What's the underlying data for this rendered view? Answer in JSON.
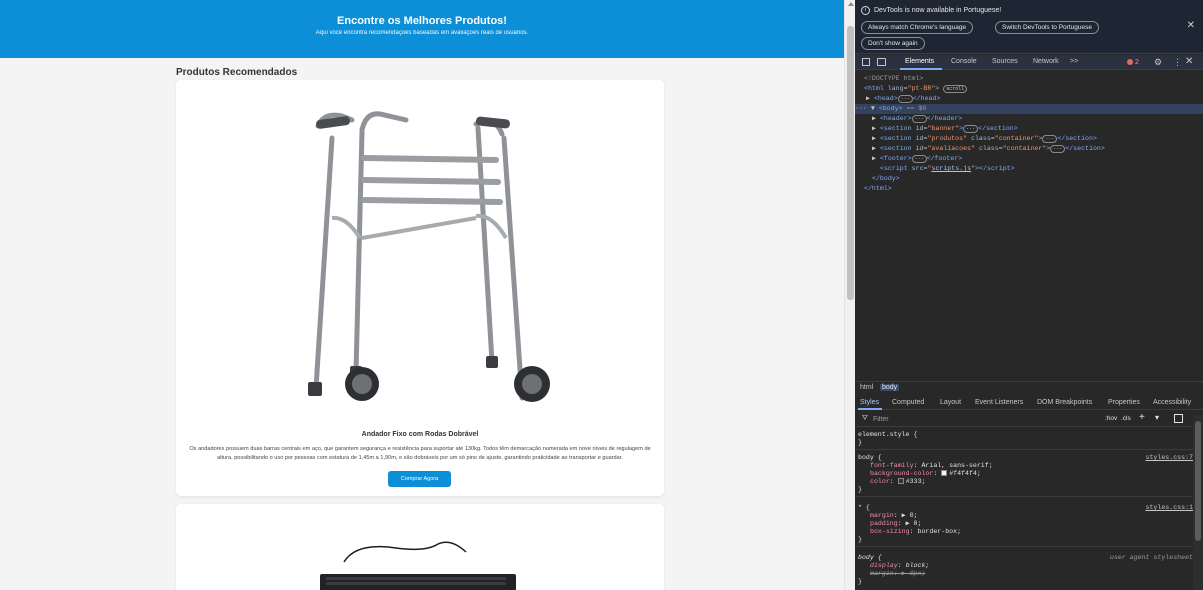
{
  "site": {
    "header_title": "Encontre os Melhores Produtos!",
    "header_subtitle": "Aqui você encontra recomendações baseadas em avaliações reais de usuários.",
    "section_title": "Produtos Recomendados",
    "products": [
      {
        "name": "Andador Fixo com Rodas Dobrável",
        "description": "Os andadores possuem duas barras centrais em aço, que garantem segurança e resistência para suportar até 130kg. Todos têm demarcação numerada em nove níveis de regulagem de altura, possibilitando o uso por pessoas com estatura de 1,45m a 1,90m, e são dobráveis por um só pino de ajuste, garantindo praticidade ao transportar e guardar.",
        "button": "Comprar Agora",
        "image": "walker-image"
      },
      {
        "image": "keyboard-image"
      }
    ],
    "accent_color": "#0d8fd8"
  },
  "devtools": {
    "infobar": {
      "message": "DevTools is now available in Portuguese!",
      "btn_match": "Always match Chrome's language",
      "btn_switch": "Switch DevTools to Portuguese",
      "btn_dont": "Don't show again"
    },
    "tabs": [
      "Elements",
      "Console",
      "Sources",
      "Network",
      ">>"
    ],
    "error_count": "2",
    "dom": {
      "doctype": "<!DOCTYPE html>",
      "html_lang": "pt-BR",
      "scroll_badge": "scroll",
      "body_selected": "== $0",
      "section_banner_id": "banner",
      "section_produtos_id": "produtos",
      "section_avaliacoes_id": "avaliacoes",
      "container_class": "container",
      "script_src": "scripts.js"
    },
    "breadcrumbs": [
      "html",
      "body"
    ],
    "subtabs": [
      "Styles",
      "Computed",
      "Layout",
      "Event Listeners",
      "DOM Breakpoints",
      "Properties",
      "Accessibility"
    ],
    "filter_placeholder": "Filter",
    "filter_hov": ":hov",
    "filter_cls": ".cls",
    "styles": {
      "element_style": "element.style {",
      "close": "}",
      "body_sel": "body {",
      "body_src": "styles.css:7",
      "ff_prop": "font-family",
      "ff_val": "Arial, sans-serif;",
      "bg_prop": "background-color",
      "bg_val": "#f4f4f4;",
      "col_prop": "color",
      "col_val": "#333;",
      "star_sel": "* {",
      "star_src": "styles.css:1",
      "margin_prop": "margin",
      "margin_val": "▶ 0;",
      "padding_prop": "padding",
      "padding_val": "▶ 0;",
      "bs_prop": "box-sizing",
      "bs_val": "border-box;",
      "ua_sel": "body {",
      "ua_src": "user agent stylesheet",
      "display_prop": "display",
      "display_val": "block;",
      "ua_margin_prop": "margin",
      "ua_margin_val": "▶ 8px;"
    }
  }
}
